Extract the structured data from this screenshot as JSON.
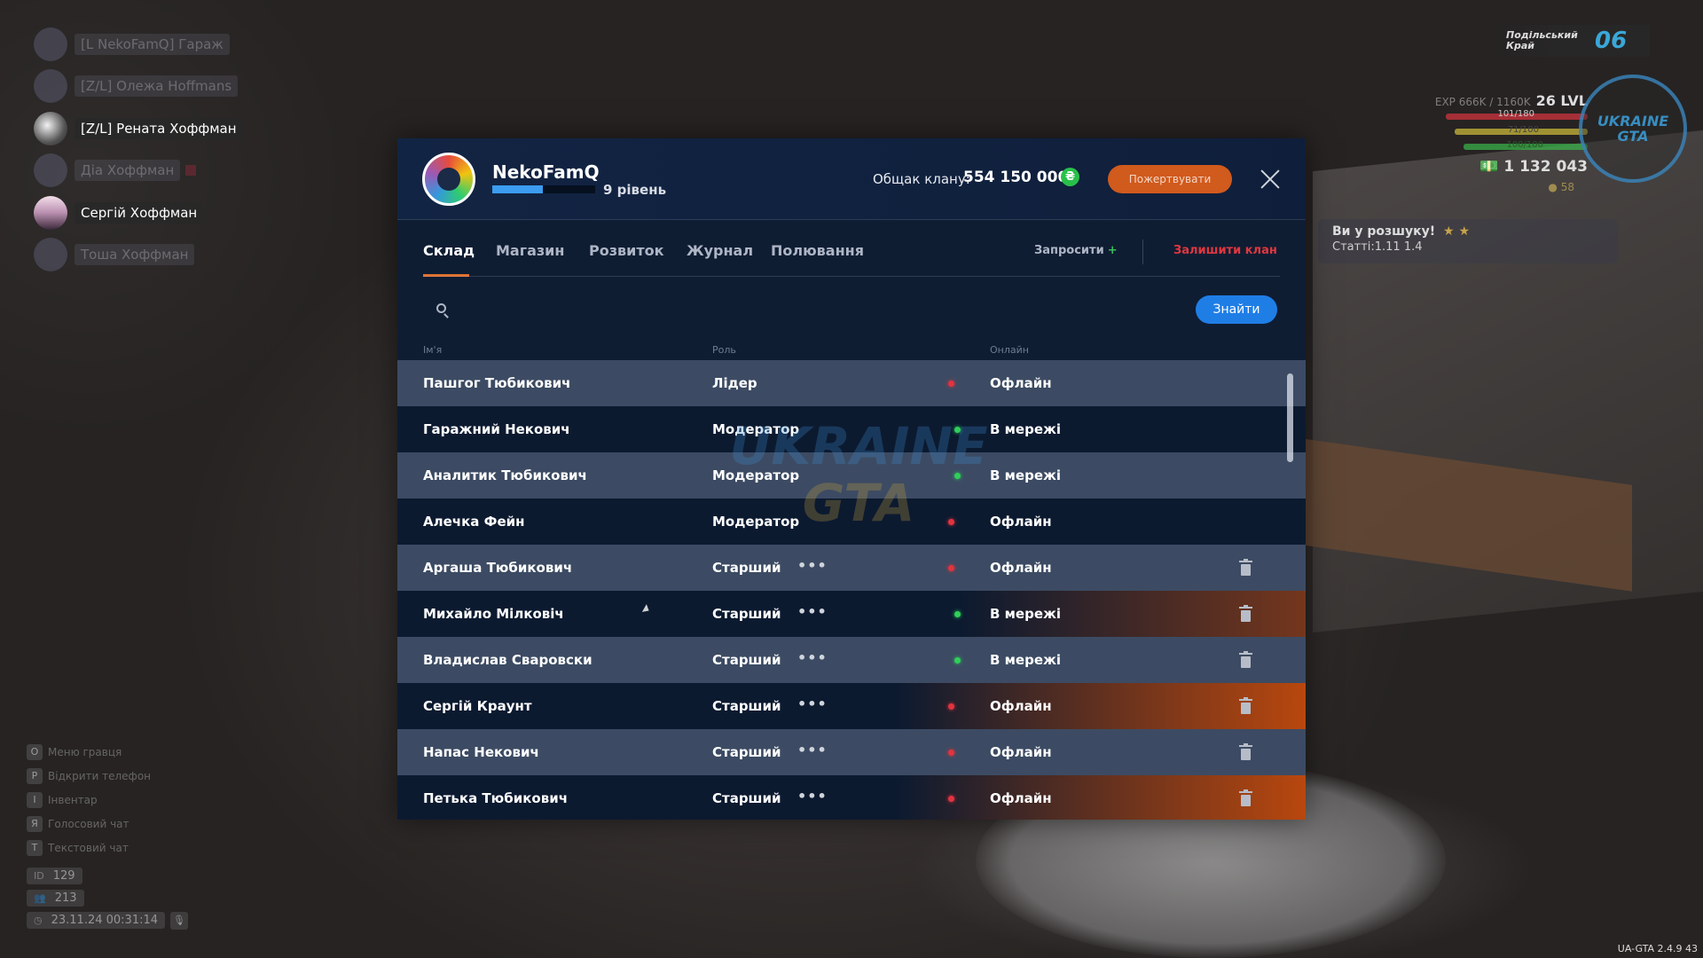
{
  "voice_chat": [
    {
      "name": "[L NekoFamQ] Гараж",
      "active": false,
      "badge": false,
      "avatar": "dim"
    },
    {
      "name": "[Z/L] Олежа Hoffmans",
      "active": false,
      "badge": false,
      "avatar": "dim"
    },
    {
      "name": "[Z/L] Рената Хоффман",
      "active": true,
      "badge": false,
      "avatar": "bright"
    },
    {
      "name": "Діа Хоффман",
      "active": false,
      "badge": true,
      "avatar": "dim"
    },
    {
      "name": "Сергій Хоффман",
      "active": true,
      "badge": false,
      "avatar": "sunset"
    },
    {
      "name": "Тоша Хоффман",
      "active": false,
      "badge": false,
      "avatar": "dim"
    }
  ],
  "hints": [
    {
      "key": "O",
      "label": "Меню гравця"
    },
    {
      "key": "P",
      "label": "Відкрити телефон"
    },
    {
      "key": "I",
      "label": "Інвентар"
    },
    {
      "key": "Я",
      "label": "Голосовий чат"
    },
    {
      "key": "T",
      "label": "Текстовий чат"
    }
  ],
  "stats": {
    "id_label": "ID",
    "id_value": "129",
    "online_value": "213",
    "datetime": "23.11.24 00:31:14"
  },
  "hud": {
    "region_name": "Подільський Край",
    "region_number": "06",
    "exp_text": "EXP 666K / 1160K",
    "level": "26 LVL",
    "hp_text": "101/180",
    "food_text": "71/100",
    "stamina_text": "100/100",
    "money": "1 132 043",
    "coins": "58",
    "logo_line1": "UKRAINE",
    "logo_line2": "GTA",
    "colors": {
      "hp": "#d0343f",
      "food": "#c9b83a",
      "stamina": "#3ab04a",
      "region_number": "#3aa7d8"
    }
  },
  "wanted": {
    "title": "Ви у розшуку!",
    "stars": "★ ★",
    "articles": "Статті:1.11 1.4"
  },
  "version": "UA-GTA 2.4.9   43",
  "clan": {
    "name": "NekoFamQ",
    "level_text": "9 рівень",
    "level_progress": 0.49,
    "treasury_label": "Общак клану:",
    "treasury_value": "554 150 000",
    "currency_icon": "hryvnia-icon",
    "donate_label": "Пожертвувати",
    "colors": {
      "accent": "#e06f2f",
      "primary": "#1f7ee6",
      "danger": "#e0373f",
      "online": "#2fcf5a",
      "offline": "#e2333f"
    },
    "tabs": [
      "Склад",
      "Магазин",
      "Розвиток",
      "Журнал",
      "Полювання"
    ],
    "active_tab": "Склад",
    "invite_label": "Запросити",
    "leave_label": "Залишити клан",
    "search_placeholder": "",
    "find_label": "Знайти",
    "columns": {
      "name": "Ім'я",
      "role": "Роль",
      "online": "Онлайн"
    },
    "watermark_line1": "UKRAINE",
    "watermark_line2": "GTA",
    "members": [
      {
        "name": "Пашгог Тюбикович",
        "role": "Лідер",
        "status": "Офлайн",
        "online": false,
        "actions": false,
        "highlight": ""
      },
      {
        "name": "Гаражний Некович",
        "role": "Модератор",
        "status": "В мережі",
        "online": true,
        "actions": false,
        "highlight": ""
      },
      {
        "name": "Аналитик Тюбикович",
        "role": "Модератор",
        "status": "В мережі",
        "online": true,
        "actions": false,
        "highlight": ""
      },
      {
        "name": "Алечка Фейн",
        "role": "Модератор",
        "status": "Офлайн",
        "online": false,
        "actions": false,
        "highlight": ""
      },
      {
        "name": "Аргаша Тюбикович",
        "role": "Старший",
        "status": "Офлайн",
        "online": false,
        "actions": true,
        "highlight": ""
      },
      {
        "name": "Михайло Мілковіч",
        "role": "Старший",
        "status": "В мережі",
        "online": true,
        "actions": true,
        "highlight": "soft"
      },
      {
        "name": "Владислав Сваровски",
        "role": "Старший",
        "status": "В мережі",
        "online": true,
        "actions": true,
        "highlight": ""
      },
      {
        "name": "Сергій Краунт",
        "role": "Старший",
        "status": "Офлайн",
        "online": false,
        "actions": true,
        "highlight": "strong"
      },
      {
        "name": "Напас Некович",
        "role": "Старший",
        "status": "Офлайн",
        "online": false,
        "actions": true,
        "highlight": ""
      },
      {
        "name": "Петька Тюбикович",
        "role": "Старший",
        "status": "Офлайн",
        "online": false,
        "actions": true,
        "highlight": "strong"
      }
    ]
  }
}
